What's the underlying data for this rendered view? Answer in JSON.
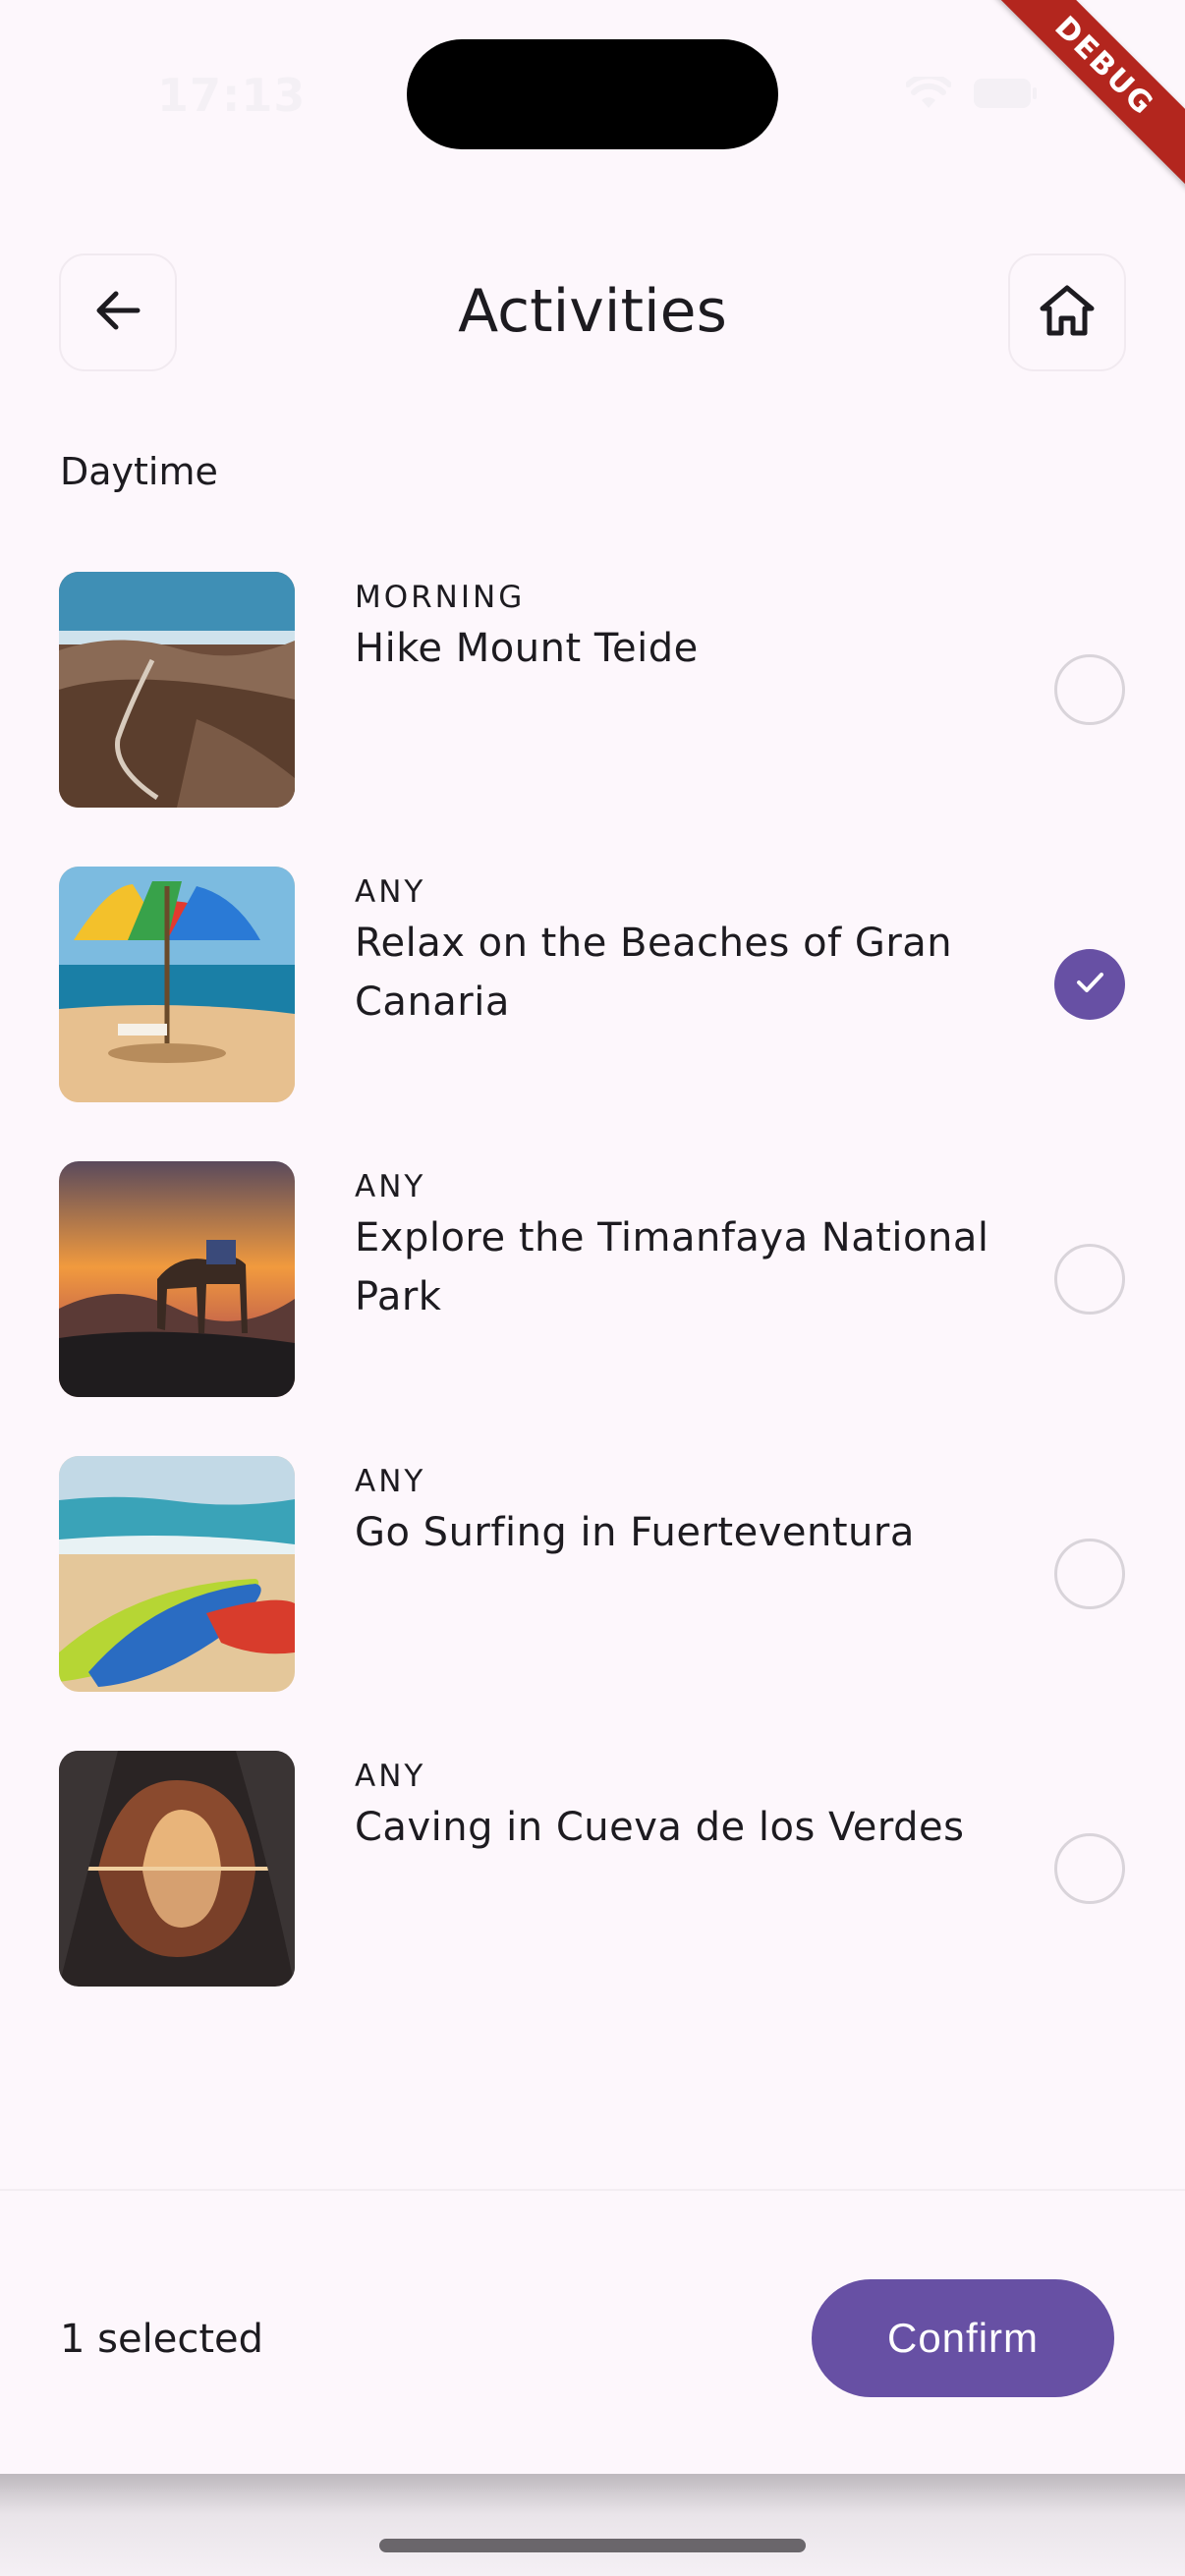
{
  "status_bar": {
    "time": "17:13"
  },
  "debug_banner": "DEBUG",
  "header": {
    "title": "Activities",
    "back_icon": "arrow-left-icon",
    "home_icon": "home-icon"
  },
  "section": {
    "label": "Daytime"
  },
  "activities": [
    {
      "tag": "MORNING",
      "name": "Hike Mount Teide",
      "selected": false
    },
    {
      "tag": "ANY",
      "name": "Relax on the Beaches of Gran Canaria",
      "selected": true
    },
    {
      "tag": "ANY",
      "name": "Explore the Timanfaya National Park",
      "selected": false
    },
    {
      "tag": "ANY",
      "name": "Go Surfing in Fuerteventura",
      "selected": false
    },
    {
      "tag": "ANY",
      "name": "Caving in Cueva de los Verdes",
      "selected": false
    }
  ],
  "footer": {
    "selected_count": "1 selected",
    "confirm_label": "Confirm"
  },
  "colors": {
    "accent": "#6750a4",
    "background": "#fdf7fc",
    "text": "#1d1b20"
  }
}
